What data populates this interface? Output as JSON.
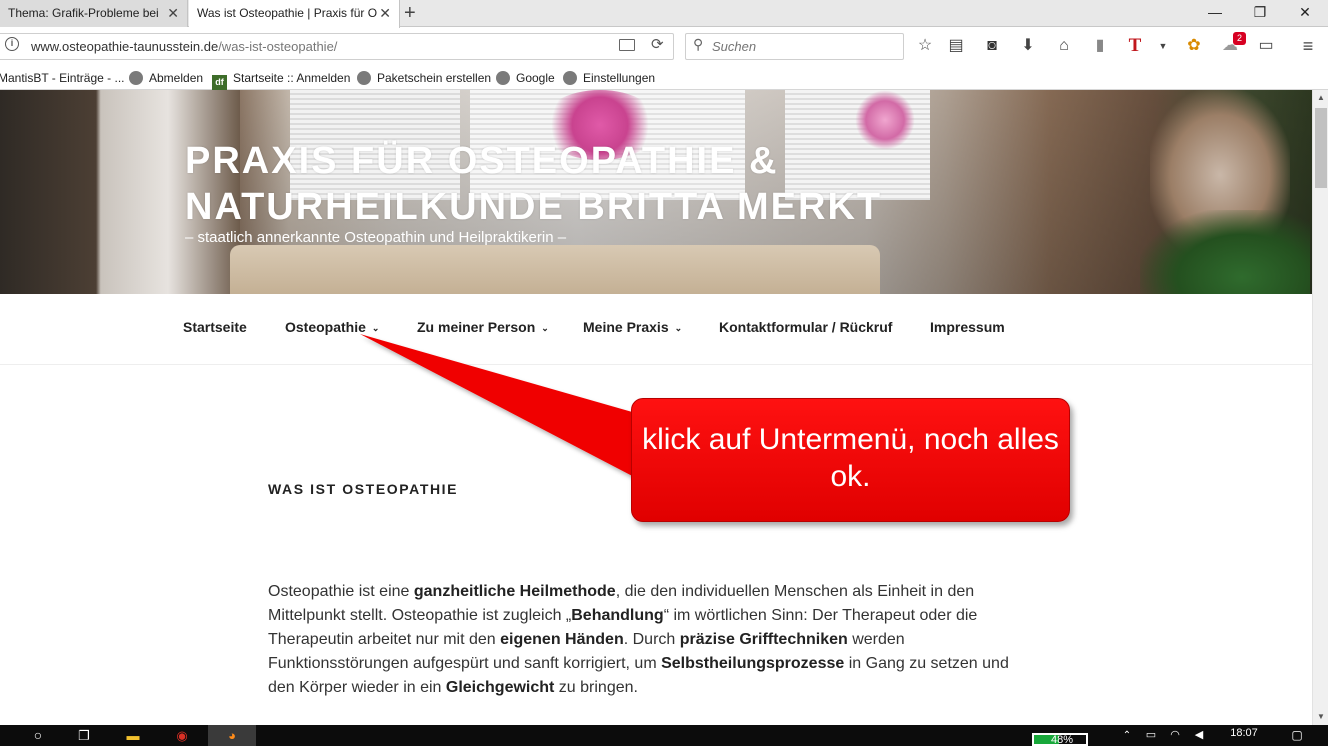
{
  "browser": {
    "tabs": [
      {
        "title": "Thema: Grafik-Probleme bei",
        "active": false
      },
      {
        "title": "Was ist Osteopathie | Praxis für O",
        "active": true
      }
    ],
    "close_glyph": "✕",
    "new_tab_glyph": "+",
    "window_controls": {
      "minimize": "—",
      "maximize": "❐",
      "close": "✕"
    },
    "url": {
      "host": "www.osteopathie-taunusstein.de",
      "path": "/was-ist-osteopathie/"
    },
    "search_placeholder": "Suchen",
    "toolbar_icons": [
      "bookmark-star-icon",
      "reading-list-icon",
      "pocket-icon",
      "download-icon",
      "home-icon",
      "library-icon",
      "translate-icon",
      "dropdown-icon",
      "extension-icon",
      "notifications-icon",
      "screen-icon",
      "menu-icon"
    ],
    "notification_count": "2",
    "bookmarks": [
      {
        "label": "MantisBT - Einträge - ..."
      },
      {
        "label": "Abmelden"
      },
      {
        "label": "Startseite :: Anmelden"
      },
      {
        "label": "Paketschein erstellen"
      },
      {
        "label": "Google"
      },
      {
        "label": "Einstellungen"
      }
    ]
  },
  "site": {
    "title": "Praxis für Osteopathie & Naturheilkunde Britta Merkt",
    "description": "– staatlich annerkannte Osteopathin und Heilpraktikerin –",
    "nav": [
      {
        "label": "Startseite",
        "has_submenu": false
      },
      {
        "label": "Osteopathie",
        "has_submenu": true
      },
      {
        "label": "Zu meiner Person",
        "has_submenu": true
      },
      {
        "label": "Meine Praxis",
        "has_submenu": true
      },
      {
        "label": "Kontaktformular / Rückruf",
        "has_submenu": false
      },
      {
        "label": "Impressum",
        "has_submenu": false
      }
    ],
    "chevron": "⌄",
    "page_heading": "WAS IST OSTEOPATHIE",
    "paragraph": {
      "p1": "Osteopathie ist eine ",
      "b1": "ganzheitliche Heilmethode",
      "p2": ", die den individuellen Menschen als Einheit in den Mittelpunkt stellt. Osteopathie ist zugleich „",
      "b2": "Behandlung",
      "p3": "“ im wörtlichen Sinn: Der Therapeut oder die Therapeutin arbeitet nur mit den ",
      "b3": "eigenen Händen",
      "p4": ". Durch ",
      "b4": "präzise Grifftechniken",
      "p5": " werden Funktionsstörungen aufgespürt und sanft korrigiert, um ",
      "b5": "Selbstheilungsprozesse",
      "p6": " in Gang zu setzen und den Körper wieder in ein ",
      "b6": "Gleichgewicht",
      "p7": " zu bringen."
    }
  },
  "annotation": {
    "callout_text": "klick auf Untermenü, noch alles ok.",
    "color": "#f00000"
  },
  "taskbar": {
    "icons": [
      "search-icon",
      "task-view-icon",
      "file-explorer-icon",
      "chrome-icon",
      "firefox-icon"
    ],
    "battery_level": 0.48,
    "battery_text": "48%",
    "time": "18:07"
  }
}
